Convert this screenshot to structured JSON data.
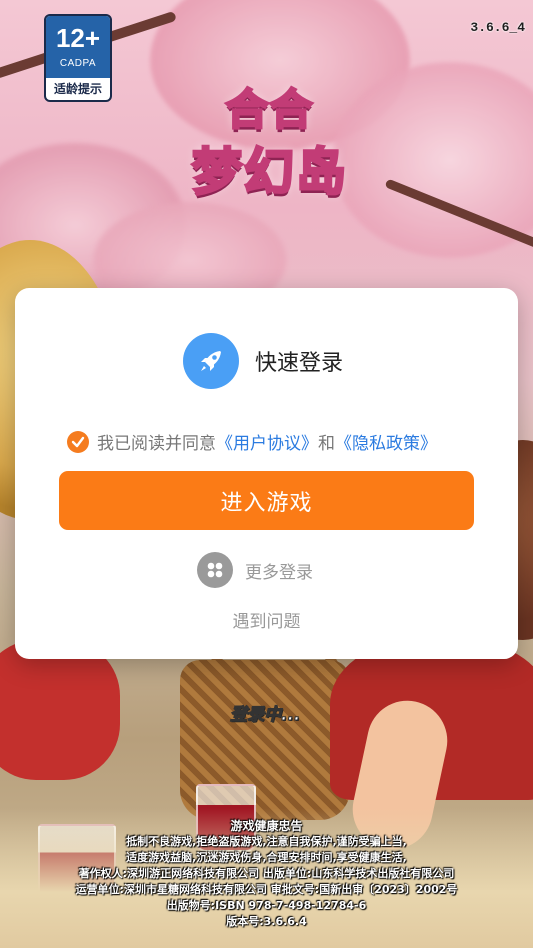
{
  "top": {
    "age_rating": "12+",
    "age_org": "CADPA",
    "age_hint": "适龄提示",
    "version": "3.6.6_4"
  },
  "logo": {
    "line1": "合合",
    "line2": "梦幻岛"
  },
  "dialog": {
    "icon": "rocket-icon",
    "title": "快速登录",
    "agree_prefix": "我已阅读并同意",
    "user_agreement": "《用户协议》",
    "and": "和",
    "privacy_policy": "《隐私政策》",
    "agreed": true,
    "enter_button": "进入游戏",
    "more_login": "更多登录",
    "problem": "遇到问题"
  },
  "status": {
    "loading": "登录中..."
  },
  "notice": {
    "title": "游戏健康忠告",
    "line1": "抵制不良游戏,拒绝盗版游戏,注意自我保护,谨防受骗上当,",
    "line2": "适度游戏益脑,沉迷游戏伤身,合理安排时间,享受健康生活,",
    "line3": "著作权人:深圳游正网络科技有限公司    出版单位:山东科学技术出版社有限公司",
    "line4": "运营单位:深圳市星糖网络科技有限公司    审批文号:国新出审〔2023〕2002号",
    "line5": "出版物号:ISBN 978-7-498-12784-6",
    "version": "版本号:3.6.6.4"
  },
  "colors": {
    "accent": "#fb7b16",
    "link": "#2b7be0",
    "rocket_bg": "#4a9ff5"
  }
}
